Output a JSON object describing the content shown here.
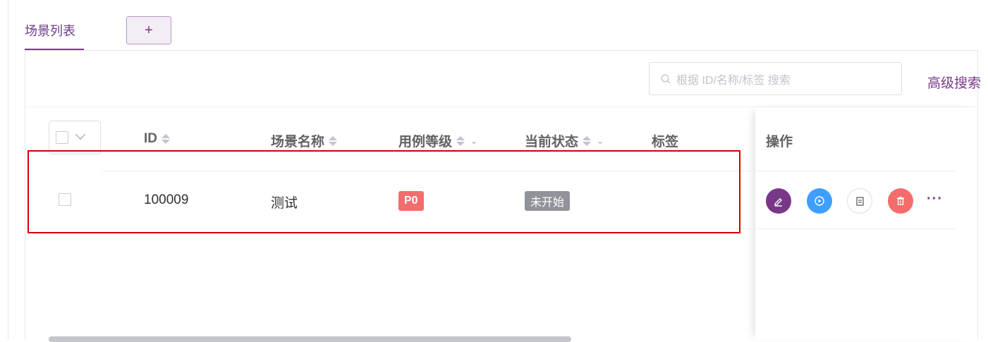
{
  "tabs": {
    "active_label": "场景列表",
    "add_label": "+"
  },
  "search": {
    "placeholder": "根据 ID/名称/标签 搜索",
    "advanced_label": "高级搜索"
  },
  "table": {
    "columns": [
      "ID",
      "场景名称",
      "用例等级",
      "当前状态",
      "标签",
      "操作"
    ],
    "rows": [
      {
        "id": "100009",
        "name": "测试",
        "level": "P0",
        "status": "未开始",
        "tags": ""
      }
    ]
  },
  "actions": {
    "more_label": "···",
    "icons": [
      "edit-icon",
      "run-icon",
      "copy-icon",
      "delete-icon",
      "more-icon"
    ]
  },
  "colors": {
    "brand": "#783887",
    "run": "#409eff",
    "danger": "#f56c6c",
    "status_gray": "#909399",
    "highlight_box": "#d40000"
  }
}
